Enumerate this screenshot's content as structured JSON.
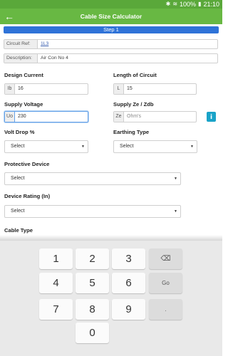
{
  "status": {
    "battery": "100%",
    "time": "21:10"
  },
  "app": {
    "title": "Cable Size Calculator"
  },
  "step": {
    "label": "Step 1"
  },
  "circuit": {
    "ref_label": "Circuit Ref:",
    "ref_value": "1L3",
    "desc_label": "Description:",
    "desc_value": "Air Con No 4"
  },
  "design_current": {
    "title": "Design Current",
    "prefix": "Ib",
    "value": "16"
  },
  "length": {
    "title": "Length of Circuit",
    "prefix": "L",
    "value": "15"
  },
  "supply_voltage": {
    "title": "Supply Voltage",
    "prefix": "Uo",
    "value": "230"
  },
  "supply_ze": {
    "title": "Supply Ze / Zdb",
    "prefix": "Ze",
    "placeholder": "Ohm's"
  },
  "volt_drop": {
    "title": "Volt Drop %",
    "value": "Select"
  },
  "earthing": {
    "title": "Earthing Type",
    "value": "Select"
  },
  "protective": {
    "title": "Protective Device",
    "value": "Select"
  },
  "device_rating": {
    "title": "Device Rating (In)",
    "value": "Select"
  },
  "cable_type": {
    "title": "Cable Type"
  },
  "keypad": {
    "k1": "1",
    "k2": "2",
    "k3": "3",
    "k4": "4",
    "k5": "5",
    "k6": "6",
    "k7": "7",
    "k8": "8",
    "k9": "9",
    "k0": "0",
    "go": "Go",
    "dot": ".",
    "backspace": "⌫"
  },
  "colors": {
    "status": "#5aa83a",
    "appbar": "#68b843",
    "step": "#2f73d8",
    "info": "#1aa3c8"
  }
}
